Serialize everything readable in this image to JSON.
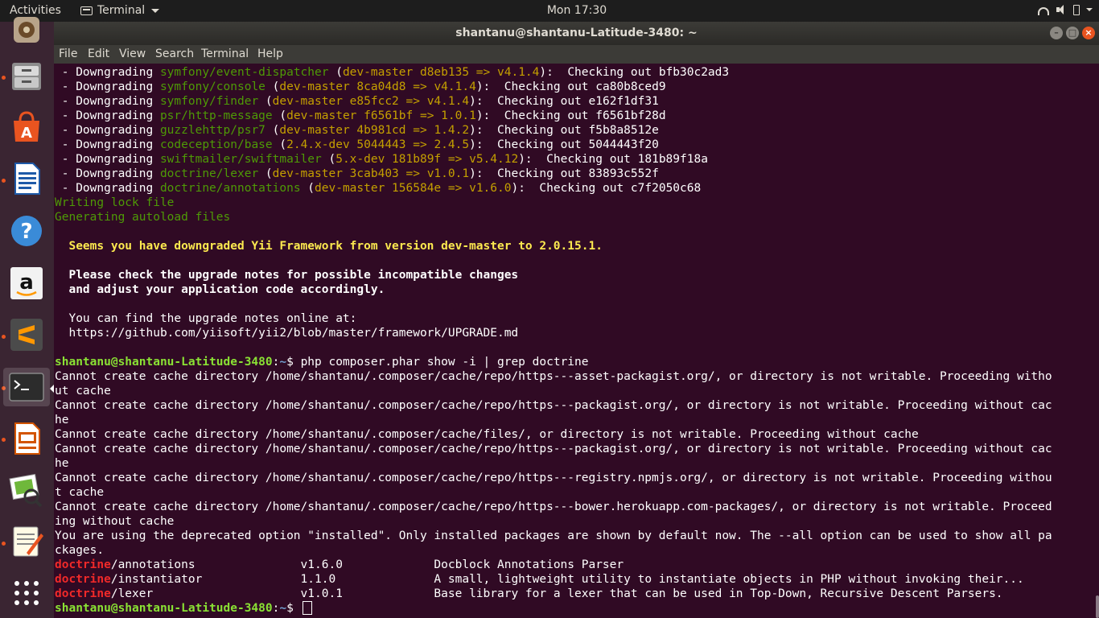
{
  "topbar": {
    "activities": "Activities",
    "app_name": "Terminal",
    "clock": "Mon 17:30"
  },
  "launcher": {
    "items": [
      "rhythmbox",
      "files",
      "ubuntu-software",
      "libreoffice-writer",
      "help",
      "amazon",
      "sublime-text",
      "terminal",
      "libreoffice-impress",
      "image-viewer",
      "text-editor",
      "show-applications"
    ]
  },
  "window": {
    "title": "shantanu@shantanu-Latitude-3480: ~",
    "menu": [
      "File",
      "Edit",
      "View",
      "Search",
      "Terminal",
      "Help"
    ]
  },
  "terminal": {
    "downgrades": [
      {
        "pkg": "symfony/event-dispatcher",
        "from": "dev-master d8eb135",
        "to": "v4.1.4",
        "sp": "  ",
        "commit": "bfb30c2ad3"
      },
      {
        "pkg": "symfony/console",
        "from": "dev-master 8ca04d8",
        "to": "v4.1.4",
        "sp": "  ",
        "commit": "ca80b8ced9"
      },
      {
        "pkg": "symfony/finder",
        "from": "dev-master e85fcc2",
        "to": "v4.1.4",
        "sp": "  ",
        "commit": "e162f1df31"
      },
      {
        "pkg": "psr/http-message",
        "from": "dev-master f6561bf",
        "to": "1.0.1",
        "sp": "  ",
        "commit": "f6561bf28d"
      },
      {
        "pkg": "guzzlehttp/psr7",
        "from": "dev-master 4b981cd",
        "to": "1.4.2",
        "sp": "  ",
        "commit": "f5b8a8512e"
      },
      {
        "pkg": "codeception/base",
        "from": "2.4.x-dev 5044443",
        "to": "2.4.5",
        "sp": "  ",
        "commit": "5044443f20"
      },
      {
        "pkg": "swiftmailer/swiftmailer",
        "from": "5.x-dev 181b89f",
        "to": "v5.4.12",
        "sp": "  ",
        "commit": "181b89f18a"
      },
      {
        "pkg": "doctrine/lexer",
        "from": "dev-master 3cab403",
        "to": "v1.0.1",
        "sp": "  ",
        "commit": "83893c552f"
      },
      {
        "pkg": "doctrine/annotations",
        "from": "dev-master 156584e",
        "to": "v1.6.0",
        "sp": "  ",
        "commit": "c7f2050c68"
      }
    ],
    "downgrade_prefix": " - Downgrading ",
    "checking_out": "Checking out ",
    "writing_lock": "Writing lock file",
    "generating_autoload": "Generating autoload files",
    "yii_warning": "  Seems you have downgraded Yii Framework from version dev-master to 2.0.15.1.",
    "upgrade_notes_1": "  Please check the upgrade notes for possible incompatible changes",
    "upgrade_notes_2": "  and adjust your application code accordingly.",
    "find_notes": "  You can find the upgrade notes online at:",
    "notes_url": "  https://github.com/yiisoft/yii2/blob/master/framework/UPGRADE.md",
    "prompt_user": "shantanu@shantanu-Latitude-3480",
    "prompt_path": "~",
    "prompt_sign": "$ ",
    "command": "php composer.phar show -i | grep doctrine",
    "output_lines": [
      "Cannot create cache directory /home/shantanu/.composer/cache/repo/https---asset-packagist.org/, or directory is not writable. Proceeding witho",
      "ut cache",
      "Cannot create cache directory /home/shantanu/.composer/cache/repo/https---packagist.org/, or directory is not writable. Proceeding without cac",
      "he",
      "Cannot create cache directory /home/shantanu/.composer/cache/files/, or directory is not writable. Proceeding without cache",
      "Cannot create cache directory /home/shantanu/.composer/cache/repo/https---packagist.org/, or directory is not writable. Proceeding without cac",
      "he",
      "Cannot create cache directory /home/shantanu/.composer/cache/repo/https---registry.npmjs.org/, or directory is not writable. Proceeding withou",
      "t cache",
      "Cannot create cache directory /home/shantanu/.composer/cache/repo/https---bower.herokuapp.com-packages/, or directory is not writable. Proceed",
      "ing without cache",
      "You are using the deprecated option \"installed\". Only installed packages are shown by default now. The --all option can be used to show all pa",
      "ckages."
    ],
    "packages": [
      {
        "match": "doctrine",
        "rest": "/annotations               ",
        "version": "v1.6.0             ",
        "desc": "Docblock Annotations Parser"
      },
      {
        "match": "doctrine",
        "rest": "/instantiator              ",
        "version": "1.1.0              ",
        "desc": "A small, lightweight utility to instantiate objects in PHP without invoking their..."
      },
      {
        "match": "doctrine",
        "rest": "/lexer                     ",
        "version": "v1.0.1             ",
        "desc": "Base library for a lexer that can be used in Top-Down, Recursive Descent Parsers."
      }
    ]
  },
  "colors": {
    "terminal_bg": "#300a24",
    "green": "#4e9a06",
    "yellow": "#c4a000",
    "red": "#ef2929",
    "prompt_user": "#8ae234",
    "prompt_path": "#729fcf"
  }
}
